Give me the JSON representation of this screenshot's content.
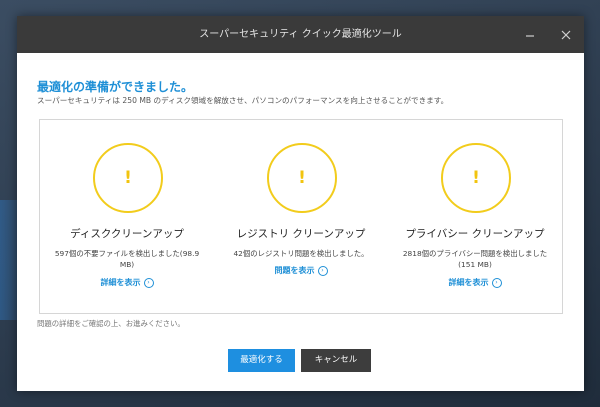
{
  "window": {
    "title": "スーパーセキュリティ クイック最適化ツール"
  },
  "header": {
    "heading": "最適化の準備ができました。",
    "subheading": "スーパーセキュリティは 250 MB のディスク領域を解放させ、パソコンのパフォーマンスを向上させることができます。"
  },
  "cards": [
    {
      "title": "ディスククリーンアップ",
      "description": "597個の不要ファイルを検出しました(98.9 MB)",
      "link": "詳細を表示",
      "icon": "alert-icon"
    },
    {
      "title": "レジストリ クリーンアップ",
      "description": "42個のレジストリ問題を検出しました。",
      "link": "問題を表示",
      "icon": "alert-icon"
    },
    {
      "title": "プライバシー クリーンアップ",
      "description": "2818個のプライバシー問題を検出しました(151 MB)",
      "link": "詳細を表示",
      "icon": "alert-icon"
    }
  ],
  "footnote": "問題の詳細をご確認の上、お進みください。",
  "buttons": {
    "optimize": "最適化する",
    "cancel": "キャンセル"
  },
  "colors": {
    "accent": "#1e8fd6",
    "alert": "#f2cc1c",
    "titlebar": "#3a3a3a",
    "cancel_button": "#3d3d3d"
  }
}
